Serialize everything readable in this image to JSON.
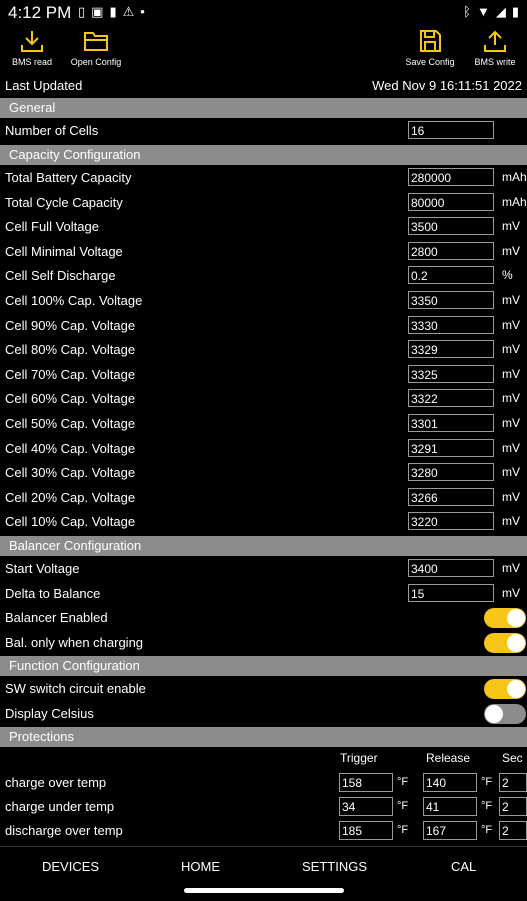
{
  "status": {
    "time": "4:12 PM",
    "icons_left": [
      "sim-icon",
      "battery-saver-icon",
      "battery-icon",
      "warning-icon",
      "dot-icon"
    ],
    "icons_right": [
      "bluetooth-icon",
      "wifi-icon",
      "signal-icon",
      "battery-icon"
    ]
  },
  "toolbar": {
    "bms_read": "BMS read",
    "open_config": "Open Config",
    "save_config": "Save Config",
    "bms_write": "BMS write",
    "accent": "#f5c518"
  },
  "last_updated": {
    "label": "Last Updated",
    "value": "Wed Nov  9 16:11:51 2022"
  },
  "sections": {
    "general": "General",
    "capacity": "Capacity Configuration",
    "balancer": "Balancer Configuration",
    "function": "Function Configuration",
    "protections": "Protections"
  },
  "general": {
    "cells_label": "Number of Cells",
    "cells_value": "16"
  },
  "capacity": [
    {
      "label": "Total Battery Capacity",
      "value": "280000",
      "unit": "mAh"
    },
    {
      "label": "Total Cycle Capacity",
      "value": "80000",
      "unit": "mAh"
    },
    {
      "label": "Cell Full Voltage",
      "value": "3500",
      "unit": "mV"
    },
    {
      "label": "Cell Minimal Voltage",
      "value": "2800",
      "unit": "mV"
    },
    {
      "label": "Cell Self Discharge",
      "value": "0.2",
      "unit": "%"
    },
    {
      "label": "Cell 100% Cap. Voltage",
      "value": "3350",
      "unit": "mV"
    },
    {
      "label": "Cell 90% Cap. Voltage",
      "value": "3330",
      "unit": "mV"
    },
    {
      "label": "Cell 80% Cap. Voltage",
      "value": "3329",
      "unit": "mV"
    },
    {
      "label": "Cell 70% Cap. Voltage",
      "value": "3325",
      "unit": "mV"
    },
    {
      "label": "Cell 60% Cap. Voltage",
      "value": "3322",
      "unit": "mV"
    },
    {
      "label": "Cell 50% Cap. Voltage",
      "value": "3301",
      "unit": "mV"
    },
    {
      "label": "Cell 40% Cap. Voltage",
      "value": "3291",
      "unit": "mV"
    },
    {
      "label": "Cell 30% Cap. Voltage",
      "value": "3280",
      "unit": "mV"
    },
    {
      "label": "Cell 20% Cap. Voltage",
      "value": "3266",
      "unit": "mV"
    },
    {
      "label": "Cell 10% Cap. Voltage",
      "value": "3220",
      "unit": "mV"
    }
  ],
  "balancer": {
    "start_label": "Start Voltage",
    "start_value": "3400",
    "start_unit": "mV",
    "delta_label": "Delta to Balance",
    "delta_value": "15",
    "delta_unit": "mV",
    "enabled_label": "Balancer Enabled",
    "enabled": true,
    "charging_label": "Bal. only when charging",
    "charging": true
  },
  "function": {
    "sw_label": "SW switch circuit enable",
    "sw": true,
    "celsius_label": "Display Celsius",
    "celsius": false
  },
  "protections": {
    "col_trigger": "Trigger",
    "col_release": "Release",
    "col_sec": "Sec",
    "rows": [
      {
        "label": "charge over temp",
        "trigger": "158",
        "trigger_unit": "°F",
        "release": "140",
        "release_unit": "°F",
        "sec": "2"
      },
      {
        "label": "charge under temp",
        "trigger": "34",
        "trigger_unit": "°F",
        "release": "41",
        "release_unit": "°F",
        "sec": "2"
      },
      {
        "label": "discharge over temp",
        "trigger": "185",
        "trigger_unit": "°F",
        "release": "167",
        "release_unit": "°F",
        "sec": "2"
      }
    ]
  },
  "nav": {
    "devices": "DEVICES",
    "home": "HOME",
    "settings": "SETTINGS",
    "cal": "CAL"
  }
}
